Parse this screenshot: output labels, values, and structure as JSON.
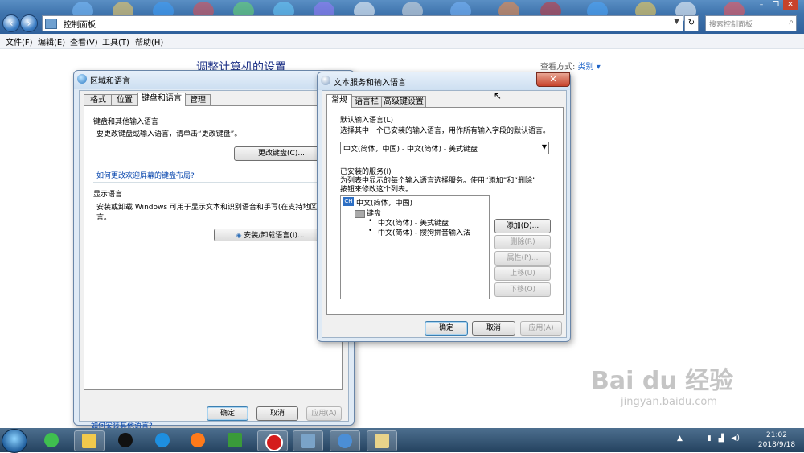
{
  "explorer": {
    "breadcrumb": "控制面板",
    "search_placeholder": "搜索控制面板",
    "menu": [
      "文件(F)",
      "编辑(E)",
      "查看(V)",
      "工具(T)",
      "帮助(H)"
    ],
    "page_title": "调整计算机的设置",
    "view_by_label": "查看方式:",
    "view_by_value": "类别 ▾"
  },
  "region_window": {
    "title": "区域和语言",
    "tabs": [
      "格式",
      "位置",
      "键盘和语言",
      "管理"
    ],
    "keyboard_group": "键盘和其他输入语言",
    "keyboard_desc": "要更改键盘或输入语言，请单击“更改键盘”。",
    "change_keyboard_button": "更改键盘(C)...",
    "welcome_link": "如何更改欢迎屏幕的键盘布局?",
    "display_group": "显示语言",
    "display_desc_1": "安装或卸载 Windows 可用于显示文本和识别语音和手写(在支持地区)的",
    "display_desc_2": "言。",
    "install_button": "安装/卸载语言(I)...",
    "more_languages_link": "如何安装其他语言?",
    "ok": "确定",
    "cancel": "取消",
    "apply": "应用(A)"
  },
  "text_services_window": {
    "title": "文本服务和输入语言",
    "tabs": [
      "常规",
      "语言栏",
      "高级键设置"
    ],
    "default_group": "默认输入语言(L)",
    "default_desc": "选择其中一个已安装的输入语言，用作所有输入字段的默认语言。",
    "default_select": "中文(简体，中国) - 中文(简体) - 美式键盘",
    "installed_group": "已安装的服务(I)",
    "installed_desc_1": "为列表中显示的每个输入语言选择服务。使用“添加”和“删除”",
    "installed_desc_2": "按钮来修改这个列表。",
    "tree": {
      "lang_badge": "CH",
      "lang": "中文(简体，中国)",
      "category": "键盘",
      "items": [
        "中文(简体) - 美式键盘",
        "中文(简体) - 搜狗拼音输入法"
      ]
    },
    "add": "添加(D)...",
    "remove": "删除(R)",
    "properties": "属性(P)...",
    "move_up": "上移(U)",
    "move_down": "下移(O)",
    "ok": "确定",
    "cancel": "取消",
    "apply": "应用(A)"
  },
  "taskbar": {
    "time": "21:02",
    "date": "2018/9/18"
  },
  "watermark": {
    "brand": "Bai du 经验",
    "url": "jingyan.baidu.com"
  }
}
